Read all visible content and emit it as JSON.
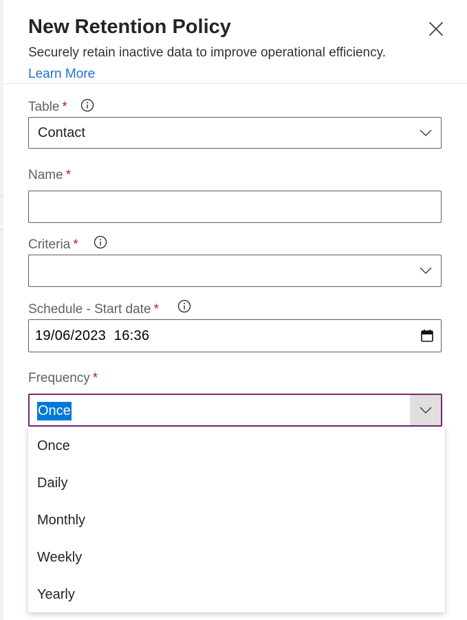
{
  "panel": {
    "title": "New Retention Policy",
    "description": "Securely retain inactive data to improve operational efficiency.",
    "learn_more": "Learn More"
  },
  "form": {
    "required_marker": "*",
    "table": {
      "label": "Table",
      "value": "Contact"
    },
    "name": {
      "label": "Name",
      "value": ""
    },
    "criteria": {
      "label": "Criteria",
      "value": ""
    },
    "schedule": {
      "label": "Schedule - Start date",
      "value": "19/06/2023  16:36"
    },
    "frequency": {
      "label": "Frequency",
      "value": "Once",
      "options": [
        "Once",
        "Daily",
        "Monthly",
        "Weekly",
        "Yearly"
      ]
    }
  },
  "colors": {
    "accent_focus": "#742774",
    "link": "#1a73d6",
    "selection": "#0078d7",
    "required": "#a4262c"
  },
  "icons": {
    "close": "close-icon",
    "info": "info-icon",
    "dropdown": "chevron-down-icon",
    "calendar": "calendar-icon"
  }
}
